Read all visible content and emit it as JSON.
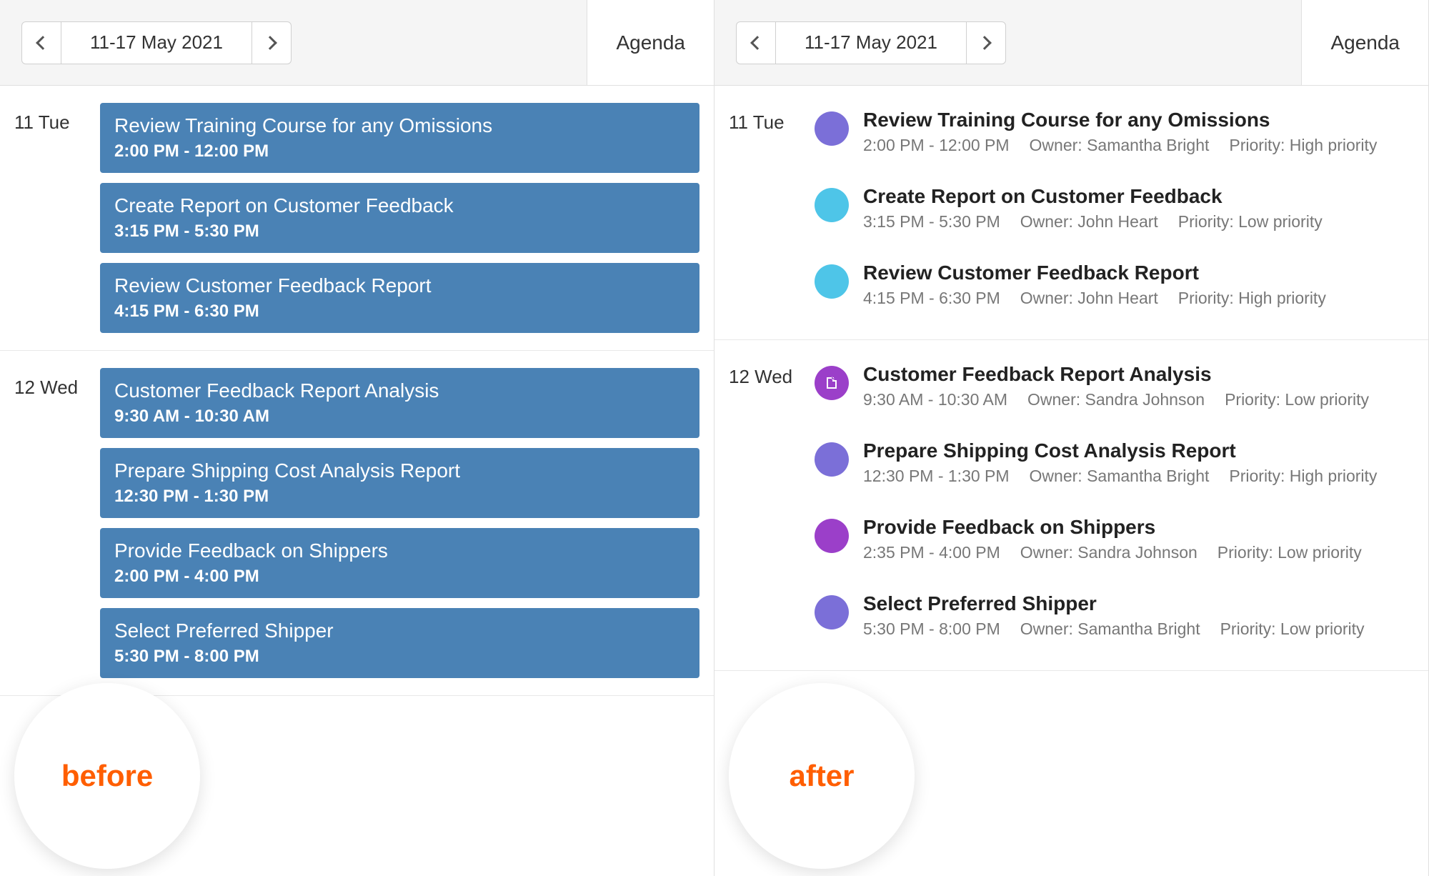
{
  "header": {
    "date_range": "11-17 May 2021",
    "view_tab": "Agenda"
  },
  "badges": {
    "before": "before",
    "after": "after"
  },
  "colors": {
    "purple": "#7b6fd8",
    "cyan": "#4ec5e8",
    "violet": "#9b3fc9",
    "blue_block": "#4a82b5"
  },
  "before": {
    "days": [
      {
        "label": "11 Tue",
        "events": [
          {
            "title": "Review Training Course for any Omissions",
            "time": "2:00 PM - 12:00 PM"
          },
          {
            "title": "Create Report on Customer Feedback",
            "time": "3:15 PM - 5:30 PM"
          },
          {
            "title": "Review Customer Feedback Report",
            "time": "4:15 PM - 6:30 PM"
          }
        ]
      },
      {
        "label": "12 Wed",
        "events": [
          {
            "title": "Customer Feedback Report Analysis",
            "time": "9:30 AM - 10:30 AM"
          },
          {
            "title": "Prepare Shipping Cost Analysis Report",
            "time": "12:30 PM - 1:30 PM"
          },
          {
            "title": "Provide Feedback on Shippers",
            "time": "2:00 PM - 4:00 PM"
          },
          {
            "title": "Select Preferred Shipper",
            "time": "5:30 PM - 8:00 PM"
          }
        ]
      }
    ]
  },
  "after": {
    "days": [
      {
        "label": "11 Tue",
        "events": [
          {
            "title": "Review Training Course for any Omissions",
            "time": "2:00 PM - 12:00 PM",
            "owner": "Owner: Samantha Bright",
            "priority": "Priority: High priority",
            "color": "purple",
            "icon": false
          },
          {
            "title": "Create Report on Customer Feedback",
            "time": "3:15 PM - 5:30 PM",
            "owner": "Owner: John Heart",
            "priority": "Priority: Low priority",
            "color": "cyan",
            "icon": false
          },
          {
            "title": "Review Customer Feedback Report",
            "time": "4:15 PM - 6:30 PM",
            "owner": "Owner: John Heart",
            "priority": "Priority: High priority",
            "color": "cyan",
            "icon": false
          }
        ]
      },
      {
        "label": "12 Wed",
        "events": [
          {
            "title": "Customer Feedback Report Analysis",
            "time": "9:30 AM - 10:30 AM",
            "owner": "Owner: Sandra Johnson",
            "priority": "Priority: Low priority",
            "color": "violet",
            "icon": true
          },
          {
            "title": "Prepare Shipping Cost Analysis Report",
            "time": "12:30 PM - 1:30 PM",
            "owner": "Owner: Samantha Bright",
            "priority": "Priority: High priority",
            "color": "purple",
            "icon": false
          },
          {
            "title": "Provide Feedback on Shippers",
            "time": "2:35 PM - 4:00 PM",
            "owner": "Owner: Sandra Johnson",
            "priority": "Priority: Low priority",
            "color": "violet",
            "icon": false
          },
          {
            "title": "Select Preferred Shipper",
            "time": "5:30 PM - 8:00 PM",
            "owner": "Owner: Samantha Bright",
            "priority": "Priority: Low priority",
            "color": "purple",
            "icon": false
          }
        ]
      }
    ]
  }
}
